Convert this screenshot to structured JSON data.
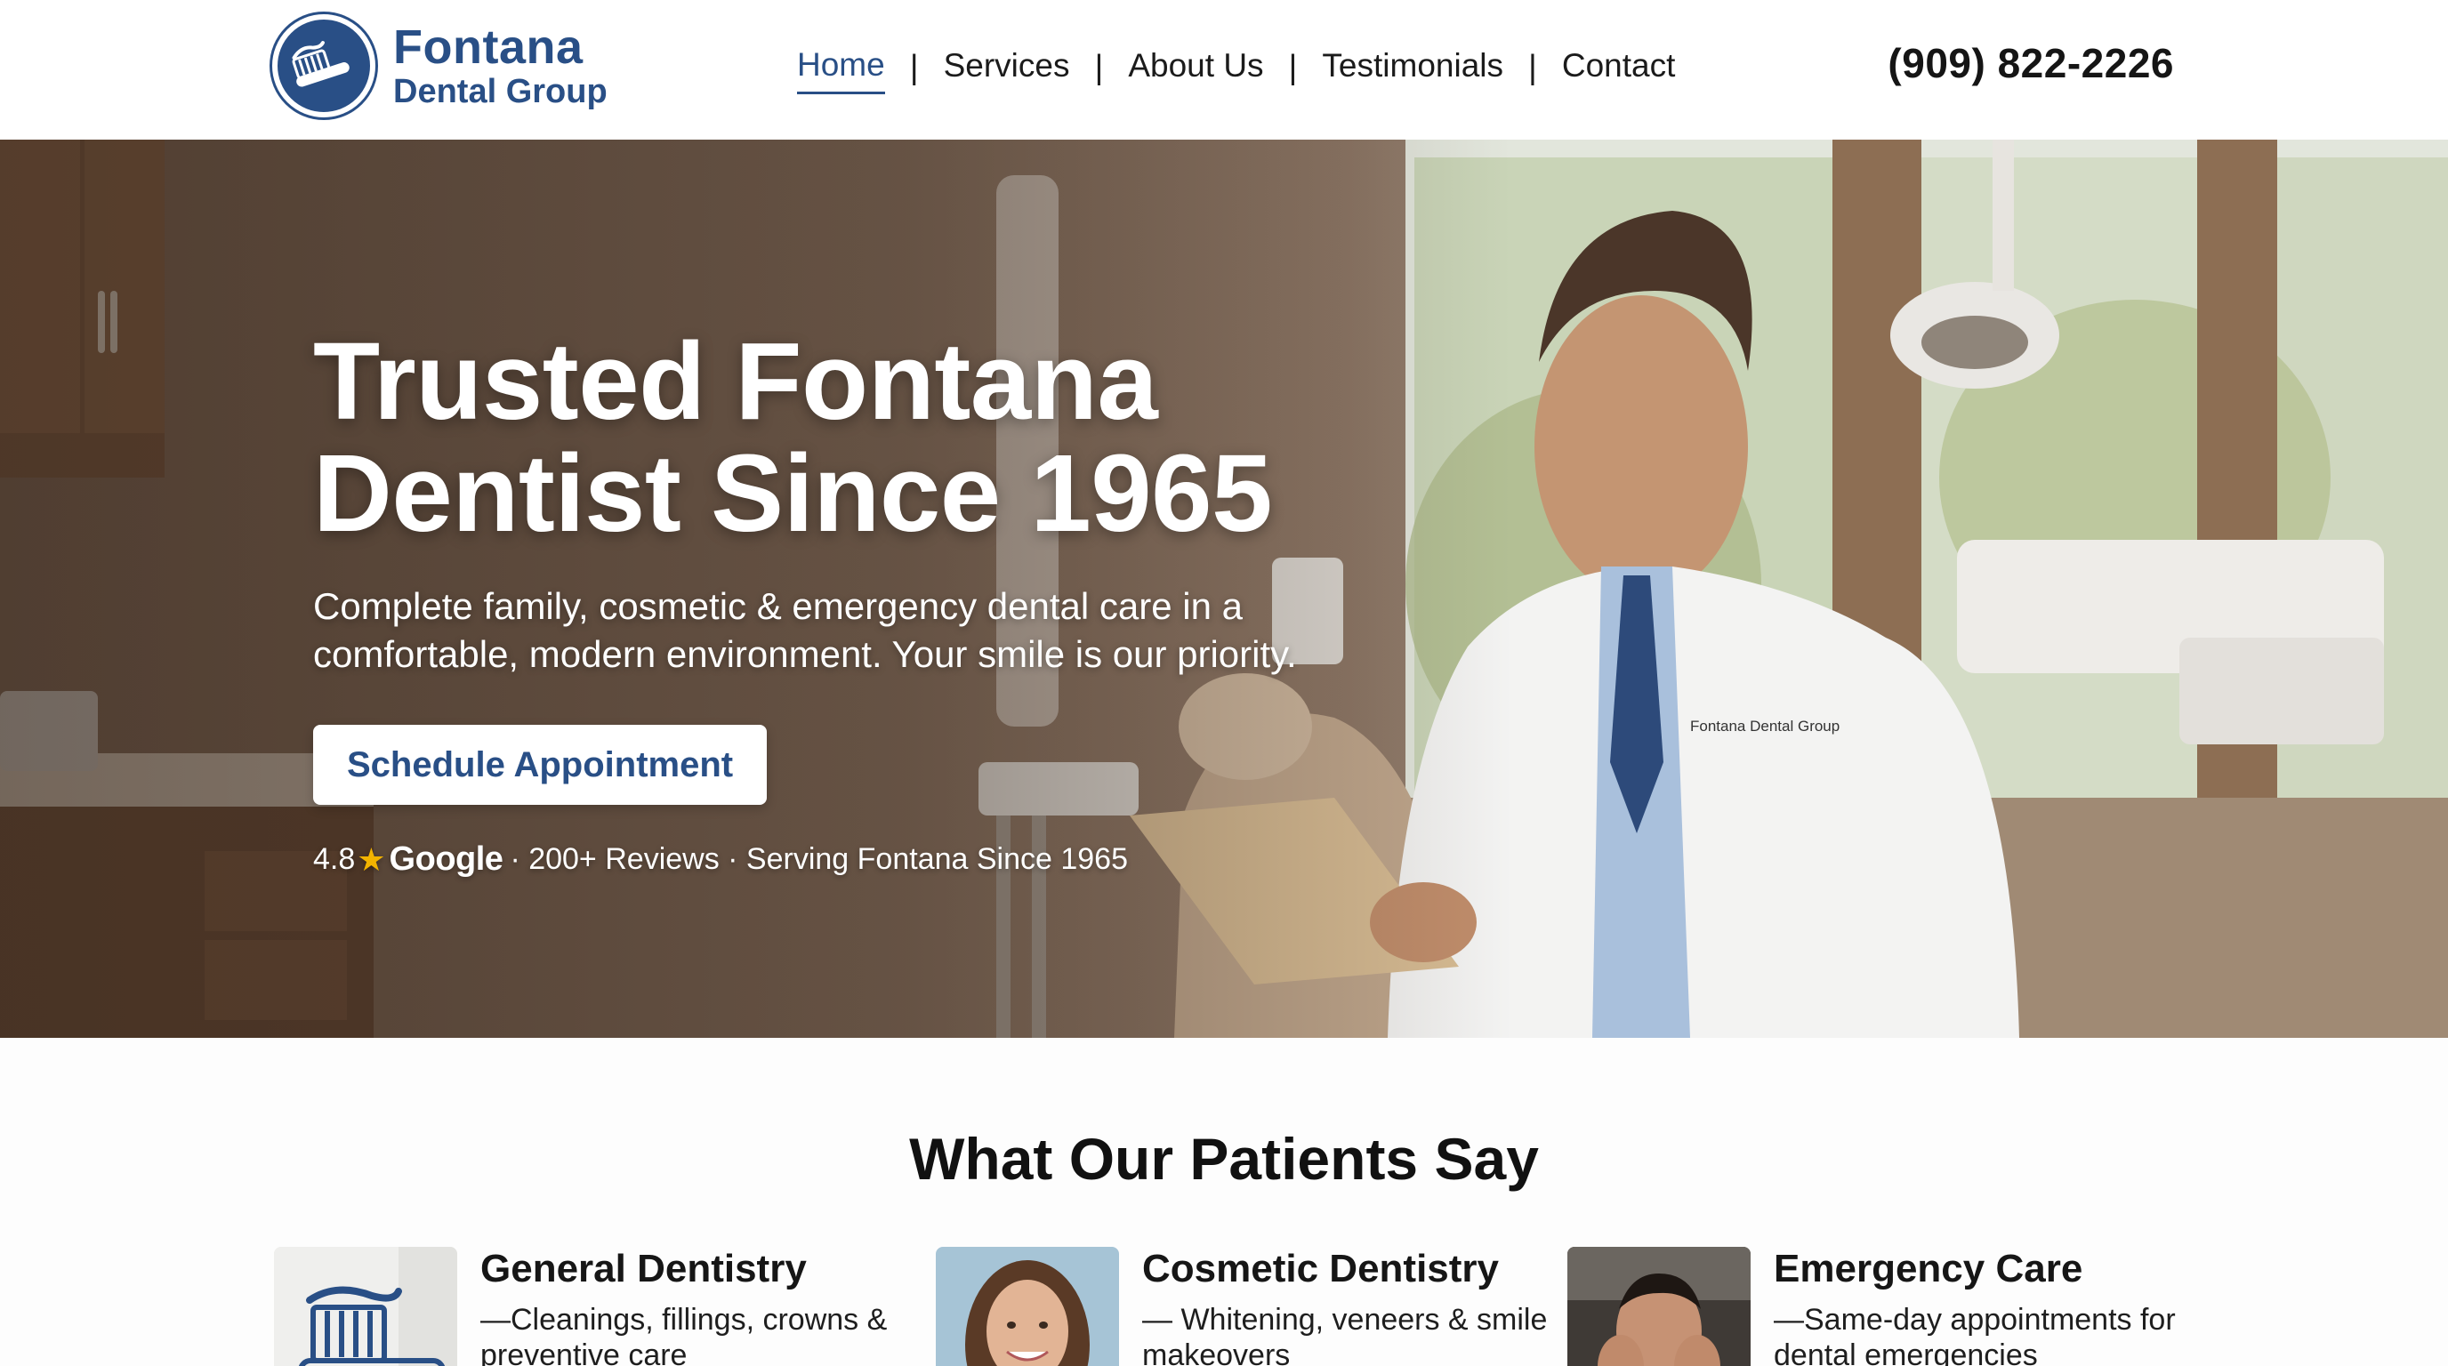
{
  "brand": {
    "name": "Fontana",
    "subtitle": "Dental Group",
    "logo_icon": "toothbrush-icon",
    "color": "#294f86"
  },
  "nav": {
    "items": [
      {
        "label": "Home",
        "active": true
      },
      {
        "label": "Services",
        "active": false
      },
      {
        "label": "About Us",
        "active": false
      },
      {
        "label": "Testimonials",
        "active": false
      },
      {
        "label": "Contact",
        "active": false
      }
    ],
    "separator": "|"
  },
  "phone": "(909) 822-2226",
  "hero": {
    "title_line1": "Trusted Fontana",
    "title_line2": "Dentist Since 1965",
    "subtitle_line1": "Complete family, cosmetic & emergency dental care in a",
    "subtitle_line2": "comfortable, modern environment. Your smile is our priority.",
    "cta_label": "Schedule Appointment",
    "rating_value": "4.8",
    "rating_platform": "Google",
    "rating_details": "· 200+ Reviews · Serving Fontana Since 1965",
    "coat_label": "Fontana Dental Group"
  },
  "section": {
    "title": "What Our Patients Say"
  },
  "cards": [
    {
      "title": "General Dentistry",
      "desc": "—Cleanings, fillings, crowns & preventive care",
      "image": "toothbrush-icon"
    },
    {
      "title": "Cosmetic Dentistry",
      "desc": "— Whitening, veneers & smile makeovers",
      "image": "smiling-woman-photo"
    },
    {
      "title": "Emergency Care",
      "desc": "—Same-day appointments for dental emergencies",
      "image": "man-with-toothache-photo"
    }
  ],
  "colors": {
    "accent": "#294f86",
    "star": "#f2b300"
  }
}
